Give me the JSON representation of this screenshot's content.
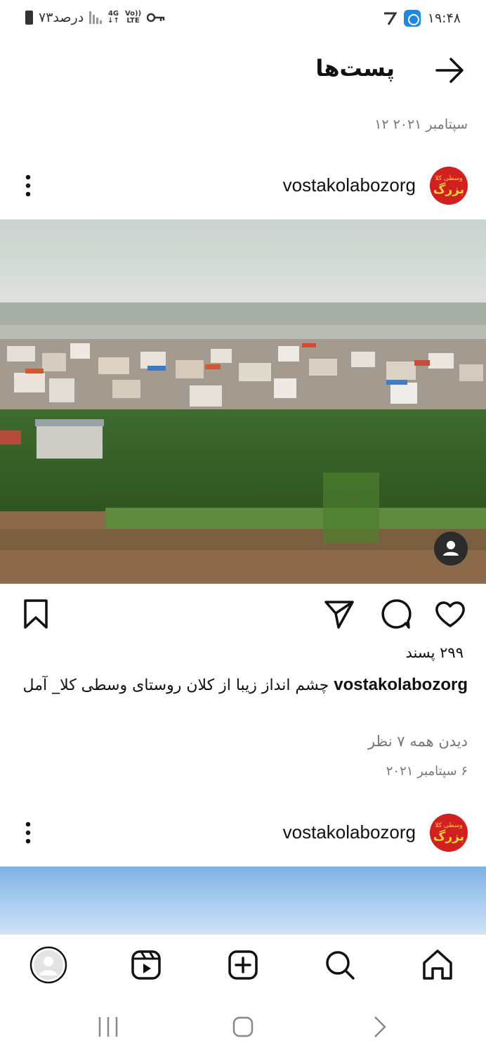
{
  "status_bar": {
    "time": "۱۹:۴۸",
    "battery_text": "۷۳درصد",
    "network_4g": "4G",
    "network_volte_top": "Vo))",
    "network_volte_bottom": "LTE"
  },
  "header": {
    "title": "پست‌ها"
  },
  "prev_post": {
    "date": "۱۲ سپتامبر ۲۰۲۱"
  },
  "post": {
    "username": "vostakolabozorg",
    "logo_text_top": "وسطی کلا",
    "logo_text_main": "بزرگ",
    "likes": "۲۹۹ پسند",
    "caption_user": "vostakolabozorg",
    "caption_text": "چشم انداز زیبا از کلان روستای وسطی کلا_ آمل",
    "view_comments": "دیدن همه ۷ نظر",
    "date": "۶ سپتامبر ۲۰۲۱"
  },
  "next_post": {
    "username": "vostakolabozorg"
  },
  "icons": {
    "back": "arrow-right-icon",
    "more": "more-vertical-icon",
    "like": "heart-icon",
    "comment": "comment-icon",
    "share": "send-icon",
    "save": "bookmark-icon",
    "home": "home-icon",
    "search": "search-icon",
    "create": "plus-square-icon",
    "reels": "reels-icon",
    "profile": "profile-avatar"
  },
  "colors": {
    "logo_red": "#d21f1f",
    "logo_yellow": "#f5d33b",
    "meta_gray": "#777777"
  }
}
